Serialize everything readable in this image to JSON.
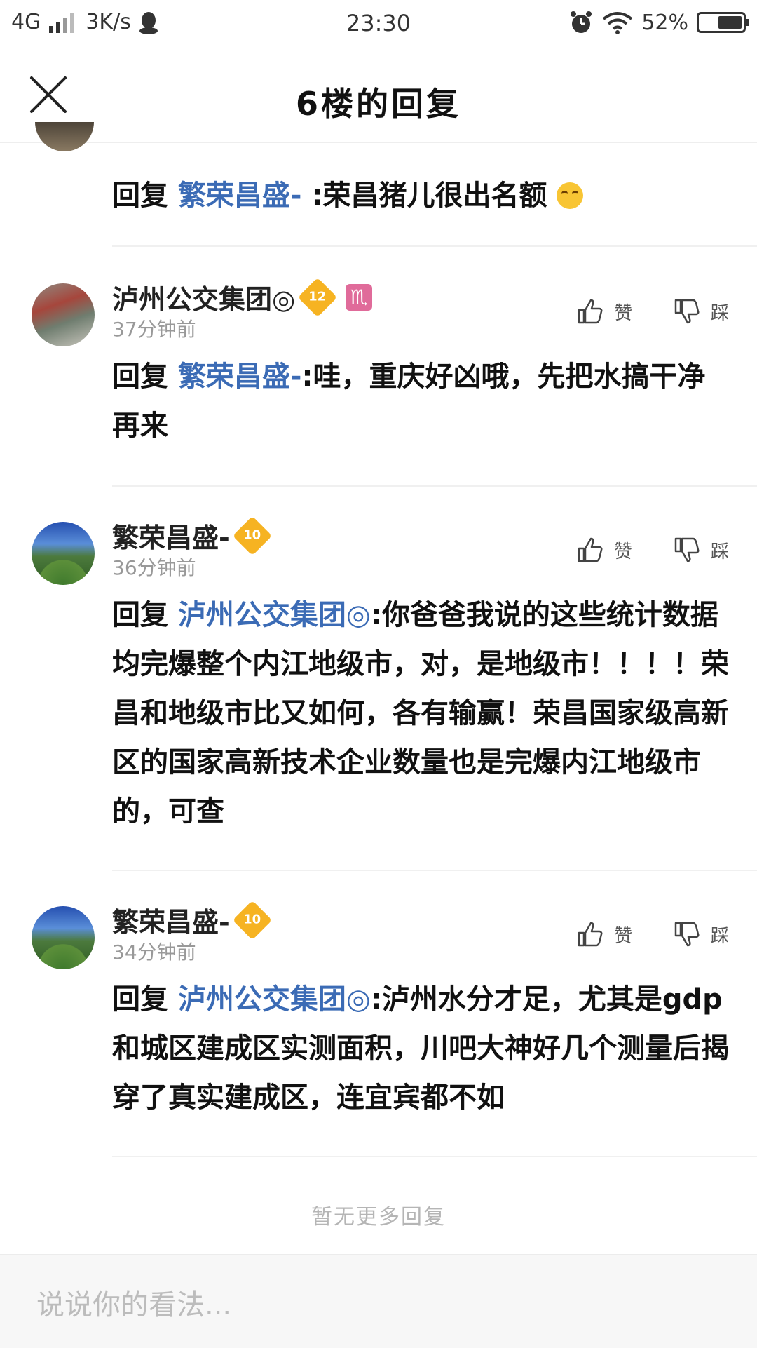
{
  "status": {
    "network": "4G",
    "speed": "3K/s",
    "time": "23:30",
    "battery": "52%"
  },
  "header": {
    "title": "6楼的回复"
  },
  "partial": {
    "prefix": "回复",
    "mention": "繁荣昌盛-",
    "text": ":荣昌猪儿很出名额"
  },
  "comments": [
    {
      "user": "泸州公交集团◎",
      "level": "12",
      "time": "37分钟前",
      "like": "赞",
      "dislike": "踩",
      "prefix": "回复",
      "mention": "繁荣昌盛-",
      "text": ":哇，重庆好凶哦，先把水搞干净再来"
    },
    {
      "user": "繁荣昌盛-",
      "level": "10",
      "time": "36分钟前",
      "like": "赞",
      "dislike": "踩",
      "prefix": "回复",
      "mention": "泸州公交集团◎",
      "text": ":你爸爸我说的这些统计数据均完爆整个内江地级市，对，是地级市！！！！荣昌和地级市比又如何，各有输赢！荣昌国家级高新区的国家高新技术企业数量也是完爆内江地级市的，可查"
    },
    {
      "user": "繁荣昌盛-",
      "level": "10",
      "time": "34分钟前",
      "like": "赞",
      "dislike": "踩",
      "prefix": "回复",
      "mention": "泸州公交集团◎",
      "text": ":泸州水分才足，尤其是gdp和城区建成区实测面积，川吧大神好几个测量后揭穿了真实建成区，连宜宾都不如"
    }
  ],
  "footer": {
    "no_more": "暂无更多回复",
    "input_placeholder": "说说你的看法..."
  },
  "icons": {
    "close": "close-icon",
    "like": "thumbs-up-icon",
    "dislike": "thumbs-down-icon",
    "zodiac": "scorpio-icon"
  }
}
